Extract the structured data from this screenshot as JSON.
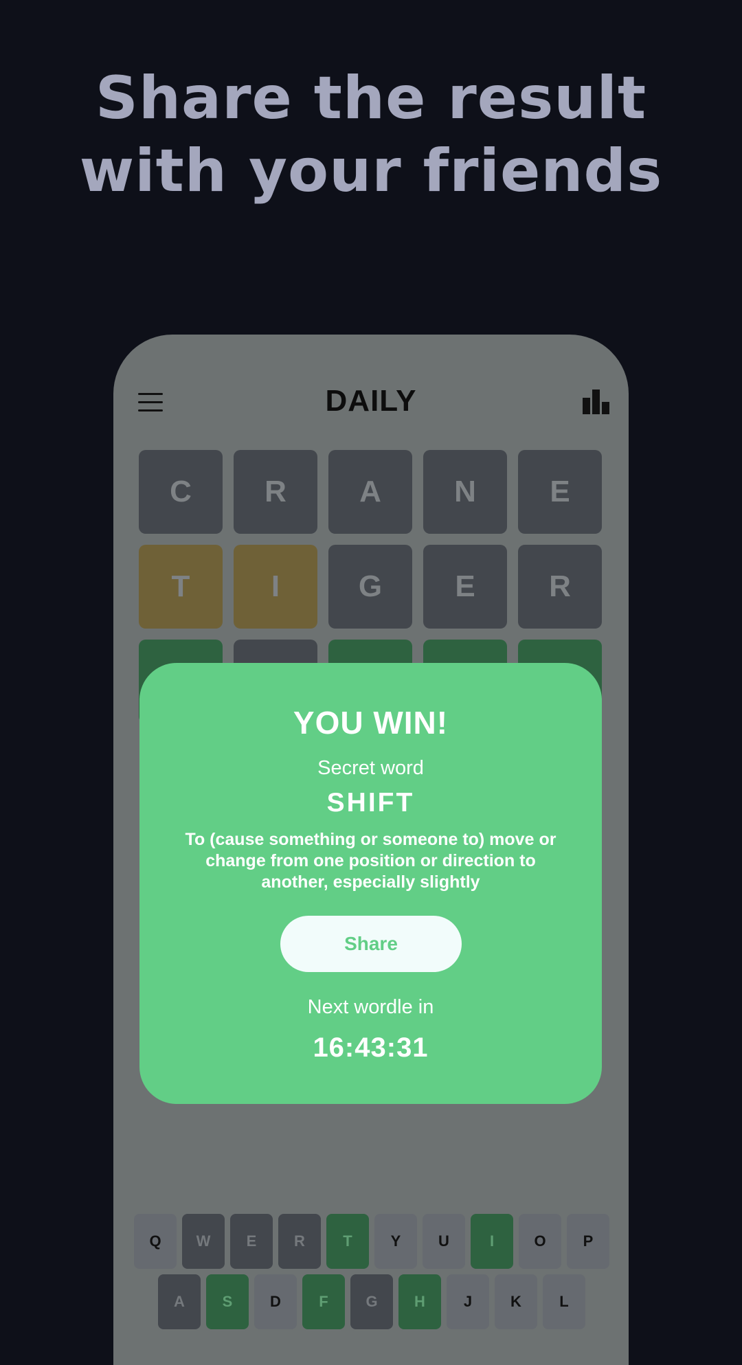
{
  "headline": {
    "line1": "Share the result",
    "line2": "with your friends"
  },
  "app": {
    "title": "DAILY",
    "icons": {
      "menu": "menu-icon",
      "stats": "stats-icon"
    }
  },
  "board": {
    "rows": [
      {
        "letters": [
          "C",
          "R",
          "A",
          "N",
          "E"
        ],
        "states": [
          "absent",
          "absent",
          "absent",
          "absent",
          "absent"
        ]
      },
      {
        "letters": [
          "T",
          "I",
          "G",
          "E",
          "R"
        ],
        "states": [
          "present",
          "present",
          "absent",
          "absent",
          "absent"
        ]
      },
      {
        "letters": [
          "",
          "",
          "",
          "",
          ""
        ],
        "states": [
          "correct",
          "absent",
          "correct",
          "correct",
          "correct"
        ]
      }
    ]
  },
  "result": {
    "title": "YOU WIN!",
    "secret_label": "Secret word",
    "secret_word": "SHIFT",
    "definition": "To (cause something or someone to) move or change from one position or direction to another, especially slightly",
    "share_label": "Share",
    "next_label": "Next wordle in",
    "countdown": "16:43:31"
  },
  "keyboard": {
    "row1": [
      "Q",
      "W",
      "E",
      "R",
      "T",
      "Y",
      "U",
      "I",
      "O",
      "P"
    ],
    "row1_states": [
      "unused",
      "absent",
      "absent",
      "absent",
      "correct",
      "unused",
      "unused",
      "correct",
      "unused",
      "unused"
    ],
    "row2": [
      "A",
      "S",
      "D",
      "F",
      "G",
      "H",
      "J",
      "K",
      "L"
    ],
    "row2_states": [
      "absent",
      "correct",
      "unused",
      "correct",
      "absent",
      "correct",
      "unused",
      "unused",
      "unused"
    ]
  },
  "colors": {
    "background": "#0e1019",
    "headline": "#a4a7bd",
    "phone_overlay": "#6d7272",
    "modal": "#62ce86",
    "tile_absent": "#43474d",
    "tile_present": "#6f6137",
    "tile_correct": "#2e6240"
  }
}
